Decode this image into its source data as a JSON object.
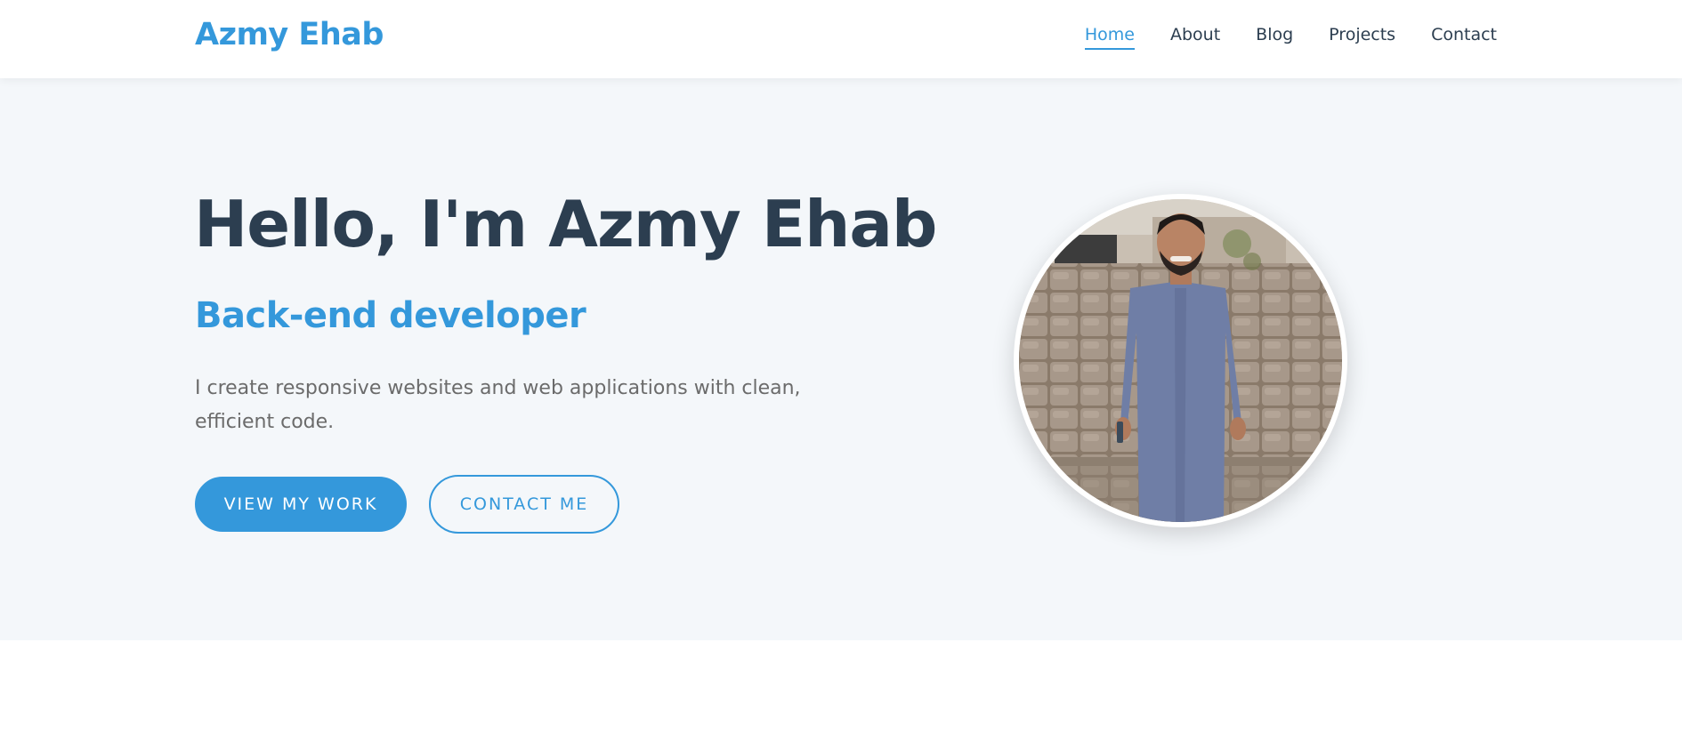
{
  "header": {
    "logo": "Azmy Ehab",
    "nav": [
      {
        "label": "Home",
        "active": true
      },
      {
        "label": "About"
      },
      {
        "label": "Blog"
      },
      {
        "label": "Projects"
      },
      {
        "label": "Contact"
      }
    ]
  },
  "hero": {
    "title": "Hello, I'm Azmy Ehab",
    "subtitle": "Back-end developer",
    "description": "I create responsive websites and web applications with clean, efficient code.",
    "primary_button": "VIEW MY WORK",
    "secondary_button": "CONTACT ME"
  },
  "colors": {
    "accent": "#3498db",
    "heading": "#2c3e50",
    "body_text": "#6b6b6b",
    "hero_background": "#f4f7fa"
  }
}
